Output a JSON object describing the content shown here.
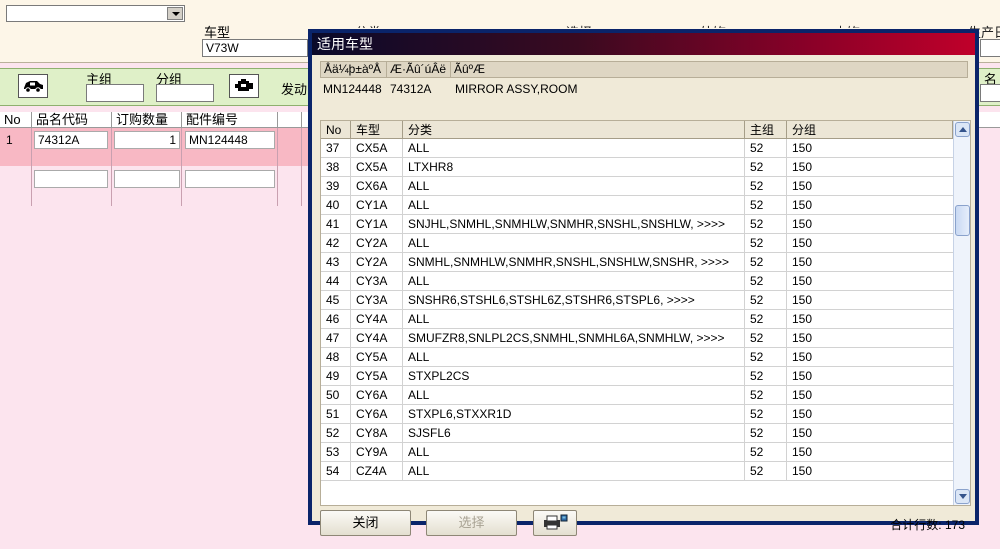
{
  "background": {
    "car_type_label": "车型",
    "car_type_value": "V73W",
    "clipped_top_texts": [
      "分类",
      "选择",
      "外饰",
      "内饰",
      "生产日"
    ],
    "main_group_label": "主组",
    "sub_group_label": "分组",
    "engine_label": "发动",
    "right_clipped": "名",
    "grid": {
      "headers": [
        "No",
        "品名代码",
        "订购数量",
        "配件编号"
      ],
      "row": {
        "no": "1",
        "code": "74312A",
        "qty": "1",
        "part": "MN124448"
      }
    }
  },
  "dialog": {
    "title": "适用车型",
    "info_headers": [
      "Åä¼þ±àºÅ",
      "Æ·Ãû´úÂë",
      "ÃûºÆ"
    ],
    "info_values": {
      "part_no": "MN124448",
      "code": "74312A",
      "name": "MIRROR ASSY,ROOM"
    },
    "columns": [
      "No",
      "车型",
      "分类",
      "主组",
      "分组"
    ],
    "rows": [
      [
        "37",
        "CX5A",
        "ALL",
        "52",
        "150"
      ],
      [
        "38",
        "CX5A",
        "LTXHR8",
        "52",
        "150"
      ],
      [
        "39",
        "CX6A",
        "ALL",
        "52",
        "150"
      ],
      [
        "40",
        "CY1A",
        "ALL",
        "52",
        "150"
      ],
      [
        "41",
        "CY1A",
        "SNJHL,SNMHL,SNMHLW,SNMHR,SNSHL,SNSHLW,  >>>>",
        "52",
        "150"
      ],
      [
        "42",
        "CY2A",
        "ALL",
        "52",
        "150"
      ],
      [
        "43",
        "CY2A",
        "SNMHL,SNMHLW,SNMHR,SNSHL,SNSHLW,SNSHR,  >>>>",
        "52",
        "150"
      ],
      [
        "44",
        "CY3A",
        "ALL",
        "52",
        "150"
      ],
      [
        "45",
        "CY3A",
        "SNSHR6,STSHL6,STSHL6Z,STSHR6,STSPL6,  >>>>",
        "52",
        "150"
      ],
      [
        "46",
        "CY4A",
        "ALL",
        "52",
        "150"
      ],
      [
        "47",
        "CY4A",
        "SMUFZR8,SNLPL2CS,SNMHL,SNMHL6A,SNMHLW,  >>>>",
        "52",
        "150"
      ],
      [
        "48",
        "CY5A",
        "ALL",
        "52",
        "150"
      ],
      [
        "49",
        "CY5A",
        "STXPL2CS",
        "52",
        "150"
      ],
      [
        "50",
        "CY6A",
        "ALL",
        "52",
        "150"
      ],
      [
        "51",
        "CY6A",
        "STXPL6,STXXR1D",
        "52",
        "150"
      ],
      [
        "52",
        "CY8A",
        "SJSFL6",
        "52",
        "150"
      ],
      [
        "53",
        "CY9A",
        "ALL",
        "52",
        "150"
      ],
      [
        "54",
        "CZ4A",
        "ALL",
        "52",
        "150"
      ]
    ],
    "buttons": {
      "close": "关闭",
      "select": "选择"
    },
    "total_label": "合计行数:",
    "total_value": "173"
  },
  "icons": {
    "toolbar_left": "car-icon",
    "toolbar_mid": "engine-icon",
    "print": "printer-icon"
  },
  "colors": {
    "title_gradient_end": "#c0002a",
    "toolbar_bg": "#dff0c8",
    "row_highlight": "#f8b8c4",
    "page_bg": "#fce4ee"
  }
}
